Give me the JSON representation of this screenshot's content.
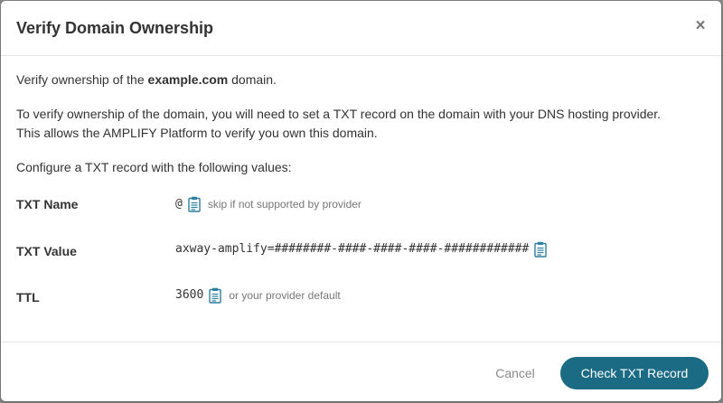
{
  "dialog": {
    "title": "Verify Domain Ownership",
    "close_glyph": "×"
  },
  "body": {
    "intro_prefix": "Verify ownership of the ",
    "domain": "example.com",
    "intro_suffix": " domain.",
    "paragraph_line1": "To verify ownership of the domain, you will need to set a TXT record on the domain with your DNS hosting provider.",
    "paragraph_line2": "This allows the AMPLIFY Platform to verify you own this domain.",
    "configure": "Configure a TXT record with the following values:"
  },
  "records": [
    {
      "label": "TXT Name",
      "value": "@",
      "hint": "skip if not supported by provider",
      "icon": "clipboard-icon"
    },
    {
      "label": "TXT Value",
      "value": "axway-amplify=########-####-####-####-############",
      "hint": "",
      "icon": "clipboard-icon"
    },
    {
      "label": "TTL",
      "value": "3600",
      "hint": "or your provider default",
      "icon": "clipboard-icon"
    }
  ],
  "footer": {
    "cancel_label": "Cancel",
    "primary_label": "Check TXT Record"
  },
  "colors": {
    "primary": "#1c6b84",
    "icon": "#2e7fa0",
    "overlay": "#8a8a8a"
  }
}
